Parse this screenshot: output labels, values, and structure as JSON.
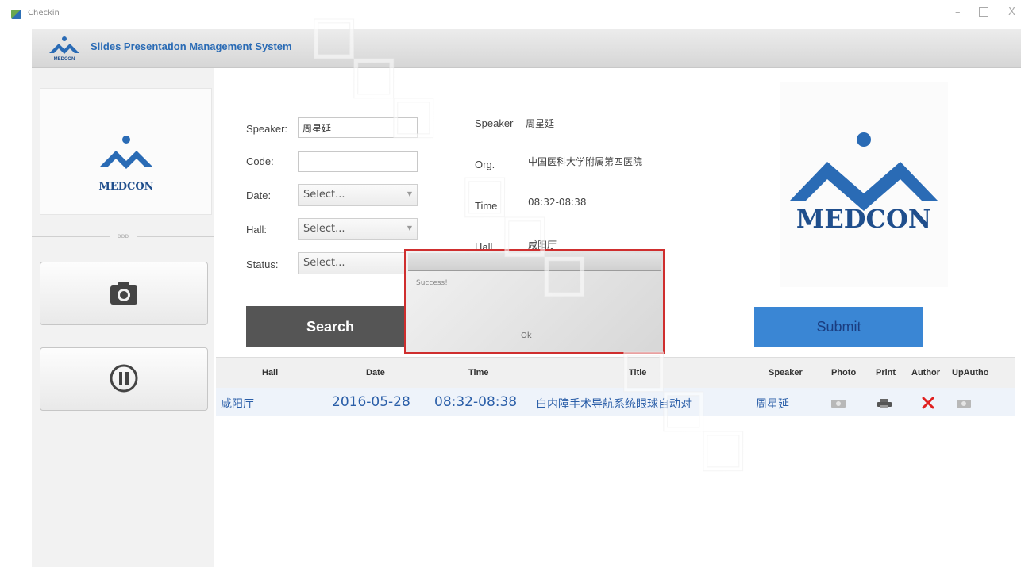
{
  "window": {
    "title": "Checkin",
    "minimize_glyph": "–",
    "close_glyph": "X"
  },
  "header": {
    "title": "Slides Presentation Management System",
    "logo_text": "MEDCON"
  },
  "left_panel": {
    "logo_text": "MEDCON",
    "separator_text": "ᴅᴅᴅ",
    "camera_icon": "camera-icon",
    "pause_icon": "pause-circle-icon"
  },
  "search_form": {
    "speaker_label": "Speaker:",
    "speaker_value": "周星延",
    "code_label": "Code:",
    "code_value": "",
    "date_label": "Date:",
    "date_value": "Select...",
    "hall_label": "Hall:",
    "hall_value": "Select...",
    "status_label": "Status:",
    "status_value": "Select...",
    "search_button": "Search"
  },
  "detail": {
    "speaker_label": "Speaker",
    "speaker_value": "周星延",
    "org_label": "Org.",
    "org_value": "中国医科大学附属第四医院",
    "time_label": "Time",
    "time_value": "08:32-08:38",
    "hall_label": "Hall",
    "hall_value": "咸阳厅"
  },
  "right_logo_text": "MEDCON",
  "submit_button": "Submit",
  "dialog": {
    "message": "Success!",
    "ok_label": "Ok"
  },
  "table": {
    "headers": [
      "Hall",
      "Date",
      "Time",
      "Title",
      "Speaker",
      "Photo",
      "Print",
      "Author",
      "UpAutho"
    ],
    "rows": [
      {
        "hall": "咸阳厅",
        "date": "2016-05-28",
        "time": "08:32-08:38",
        "title": "白内障手术导航系统眼球自动对",
        "speaker": "周星延",
        "photo_icon": "photo-icon",
        "print_icon": "printer-icon",
        "author_icon": "x-icon",
        "upauthor_icon": "photo-icon"
      }
    ]
  },
  "colors": {
    "brand_blue": "#2a6bb5",
    "submit_blue": "#3a86d4",
    "search_gray": "#555555",
    "dialog_border": "#cf2e2e",
    "author_x_red": "#e02020"
  }
}
